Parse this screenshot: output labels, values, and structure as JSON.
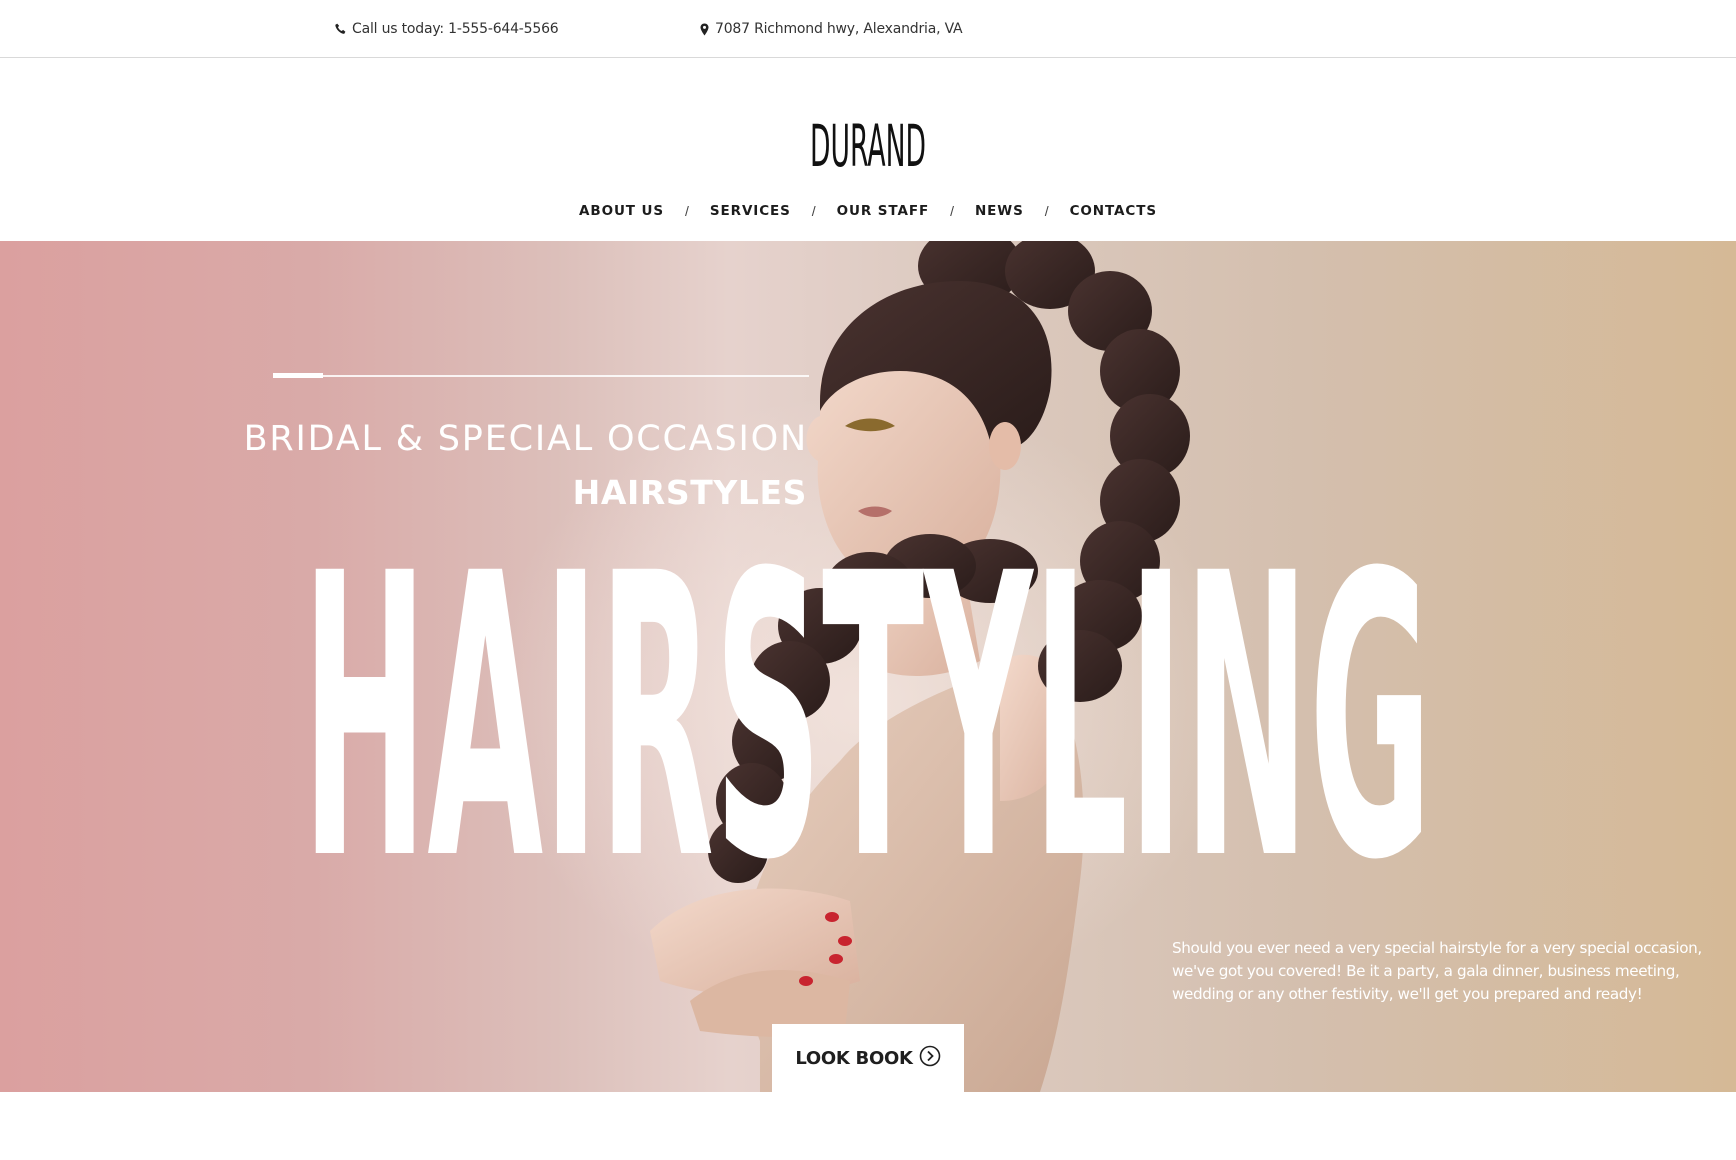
{
  "topbar": {
    "phone_text": "Call us  today: 1-555-644-5566",
    "phone_icon": "phone-icon",
    "address_text": "7087 Richmond hwy, Alexandria, VA",
    "address_icon": "map-marker-icon"
  },
  "header": {
    "logo_text": "DURAND",
    "nav": {
      "about": "ABOUT US",
      "services": "SERVICES",
      "staff": "OUR STAFF",
      "news": "NEWS",
      "contacts": "CONTACTS",
      "separator": "/"
    }
  },
  "hero": {
    "eyebrow": "BRIDAL & SPECIAL OCCASION",
    "subtitle": "HAIRSTYLES",
    "big_word": "HAIRSTYLING",
    "description": "Should you ever need a very special hairstyle for a very special occasion, we've got you covered! Be it a party, a gala dinner, business meeting, wedding or any other festivity, we'll get you prepared and ready!",
    "button_label": "LOOK BOOK",
    "button_icon": "circle-chevron-right-icon"
  },
  "colors": {
    "hero_left": "#dba09f",
    "hero_right": "#d5b996",
    "text_dark": "#1c1c1c"
  }
}
